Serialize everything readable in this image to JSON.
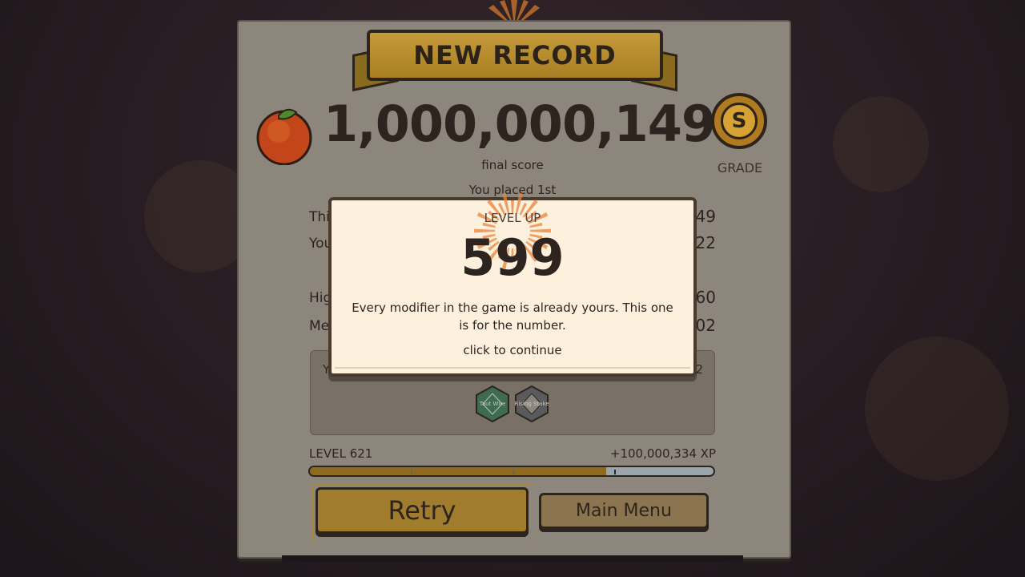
{
  "banner": {
    "title": "NEW RECORD"
  },
  "score": {
    "value": "1,000,000,149",
    "label": "final score"
  },
  "grade": {
    "letter": "S",
    "label": "GRADE"
  },
  "placement": "You placed 1st",
  "stats": [
    {
      "label": "Thi",
      "value": "49"
    },
    {
      "label": "You",
      "value": "22"
    },
    {
      "label": "Hig",
      "value": "60"
    },
    {
      "label": "Mer",
      "value": "02"
    }
  ],
  "modifiers_header": {
    "left": "Y",
    "right": "2"
  },
  "modifiers": [
    {
      "label": "Taut Wire",
      "color": "#3f6b52"
    },
    {
      "label": "Rising Stake",
      "color": "#5b5a5c"
    }
  ],
  "level": {
    "label": "LEVEL 621",
    "xp_gain": "+100,000,334 XP",
    "progress": 0.735
  },
  "buttons": {
    "retry": "Retry",
    "main_menu": "Main Menu"
  },
  "popup": {
    "title": "LEVEL UP",
    "number": "599",
    "message": "Every modifier in the game is already yours. This one is for the number.",
    "continue": "click to continue"
  },
  "colors": {
    "accent": "#a07c2c",
    "popup_bg": "#fdf0dc",
    "text": "#2d241f",
    "burst": "#e07a2a"
  }
}
